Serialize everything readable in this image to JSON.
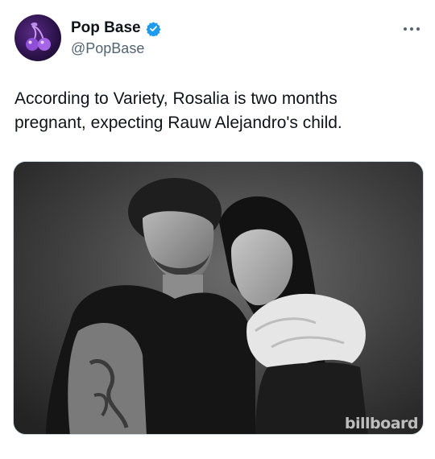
{
  "account": {
    "display_name": "Pop Base",
    "handle": "@PopBase",
    "verified": true,
    "avatar_icon": "cherry-logo-icon",
    "verified_color": "#1d9bf0"
  },
  "menu": {
    "icon": "more-horizontal-icon"
  },
  "tweet": {
    "text": "According to Variety, Rosalia is two months\npregnant, expecting Rauw Alejandro's child."
  },
  "media": {
    "type": "photo",
    "style": "black-and-white portrait",
    "watermark": "billboard"
  },
  "colors": {
    "text_primary": "#0f1419",
    "text_secondary": "#536471",
    "border": "#cfd9de"
  }
}
